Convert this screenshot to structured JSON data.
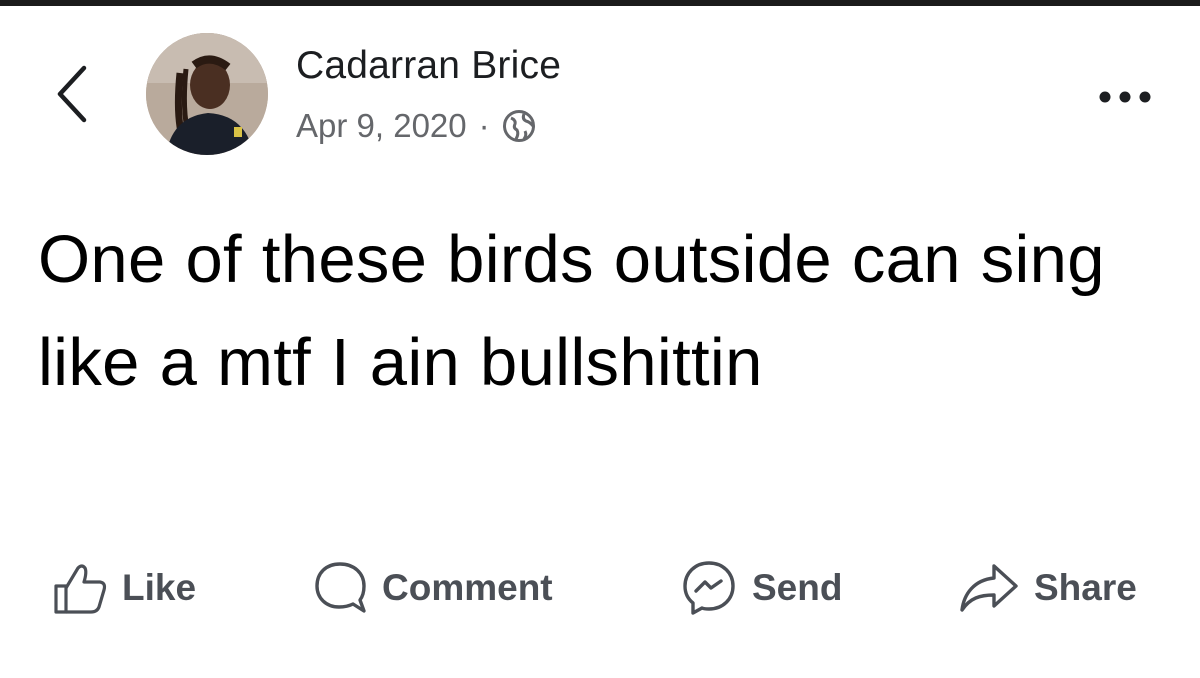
{
  "post": {
    "author": "Cadarran Brice",
    "date": "Apr 9, 2020",
    "separator": "·",
    "privacy_icon": "globe-icon",
    "text": "One of these birds outside can sing like a mtf I ain bullshittin"
  },
  "header": {
    "back_icon": "chevron-left-icon",
    "more_icon": "more-horizontal-icon"
  },
  "actions": [
    {
      "label": "Like",
      "icon": "thumbs-up-icon"
    },
    {
      "label": "Comment",
      "icon": "comment-bubble-icon"
    },
    {
      "label": "Send",
      "icon": "messenger-icon"
    },
    {
      "label": "Share",
      "icon": "share-arrow-icon"
    }
  ],
  "colors": {
    "text": "#000000",
    "secondary": "#65676b",
    "action": "#4b4f56",
    "background": "#ffffff"
  }
}
